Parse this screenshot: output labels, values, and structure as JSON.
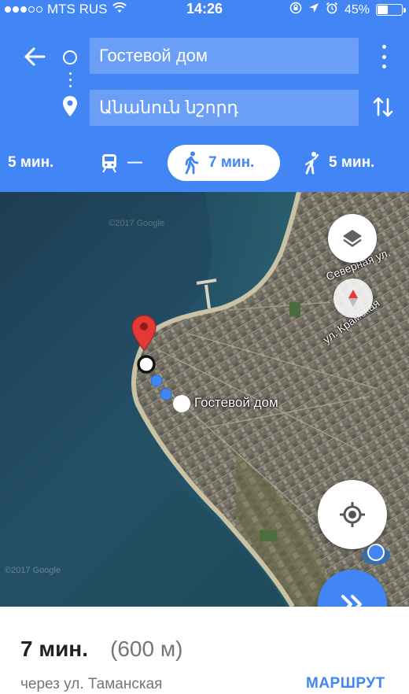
{
  "status_bar": {
    "carrier": "MTS RUS",
    "time": "14:26",
    "battery_text": "45%",
    "battery_level": 0.45,
    "signal_bars_filled": 3,
    "signal_bars_total": 5
  },
  "header": {
    "origin_field": "Гостевой дом",
    "destination_field": "Անանուն նշորդ"
  },
  "modes": [
    {
      "name": "drive",
      "label": "5 мин."
    },
    {
      "name": "transit",
      "label": "—"
    },
    {
      "name": "walk",
      "label": "7 мин.",
      "selected": true
    },
    {
      "name": "other",
      "label": "5 мин."
    }
  ],
  "map": {
    "place_label": "Гостевой дом",
    "street_labels": [
      "Северная ул.",
      "ул. Крамская"
    ],
    "watermark": "©2017 Google",
    "route_color": "#4285f4",
    "pin_color": "#e53935"
  },
  "summary": {
    "duration": "7 мин.",
    "distance": "(600 м)",
    "via": "через ул. Таманская",
    "route_button": "МАРШРУТ"
  },
  "colors": {
    "brand": "#4285f4",
    "text_primary": "#212121",
    "text_secondary": "#757575"
  }
}
